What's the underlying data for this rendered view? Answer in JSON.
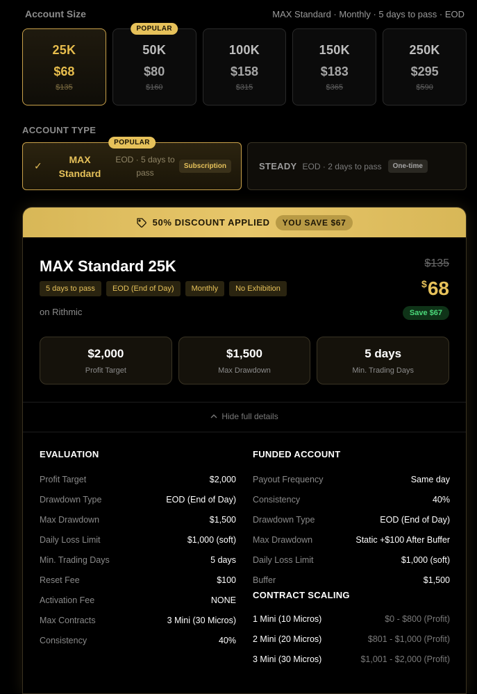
{
  "header": {
    "account_size_label": "Account Size",
    "summary": "MAX Standard · Monthly · 5 days to pass · EOD"
  },
  "account_sizes": [
    {
      "name": "25K",
      "price": "$68",
      "old_price": "$135",
      "selected": true,
      "badge": ""
    },
    {
      "name": "50K",
      "price": "$80",
      "old_price": "$160",
      "selected": false,
      "badge": "POPULAR"
    },
    {
      "name": "100K",
      "price": "$158",
      "old_price": "$315",
      "selected": false,
      "badge": ""
    },
    {
      "name": "150K",
      "price": "$183",
      "old_price": "$365",
      "selected": false,
      "badge": ""
    },
    {
      "name": "250K",
      "price": "$295",
      "old_price": "$590",
      "selected": false,
      "badge": ""
    }
  ],
  "account_type": {
    "label": "ACCOUNT TYPE",
    "max": {
      "check": "✓",
      "name_line1": "MAX",
      "name_line2": "Standard",
      "desc": "EOD · 5 days to pass",
      "tag": "Subscription",
      "badge": "POPULAR"
    },
    "steady": {
      "name": "STEADY",
      "desc": "EOD · 2 days to pass",
      "tag": "One-time"
    }
  },
  "banner": {
    "icon": "tag-icon",
    "text": "50% DISCOUNT APPLIED",
    "save": "YOU SAVE $67"
  },
  "plan": {
    "title": "MAX Standard 25K",
    "chips": [
      "5 days to pass",
      "EOD (End of Day)",
      "Monthly",
      "No Exhibition"
    ],
    "platform": "on Rithmic",
    "old_price": "$135",
    "currency": "$",
    "price": "68",
    "save": "Save $67"
  },
  "stats": [
    {
      "value": "$2,000",
      "label": "Profit Target"
    },
    {
      "value": "$1,500",
      "label": "Max Drawdown"
    },
    {
      "value": "5 days",
      "label": "Min. Trading Days"
    }
  ],
  "toggle": {
    "icon": "chevron-up-icon",
    "label": "Hide full details"
  },
  "evaluation": {
    "title": "EVALUATION",
    "rows": [
      {
        "k": "Profit Target",
        "v": "$2,000"
      },
      {
        "k": "Drawdown Type",
        "v": "EOD (End of Day)"
      },
      {
        "k": "Max Drawdown",
        "v": "$1,500"
      },
      {
        "k": "Daily Loss Limit",
        "v": "$1,000 (soft)"
      },
      {
        "k": "Min. Trading Days",
        "v": "5 days"
      },
      {
        "k": "Reset Fee",
        "v": "$100"
      },
      {
        "k": "Activation Fee",
        "v": "NONE"
      },
      {
        "k": "Max Contracts",
        "v": "3 Mini (30 Micros)"
      },
      {
        "k": "Consistency",
        "v": "40%"
      }
    ]
  },
  "funded": {
    "title": "FUNDED ACCOUNT",
    "rows": [
      {
        "k": "Payout Frequency",
        "v": "Same day"
      },
      {
        "k": "Consistency",
        "v": "40%"
      },
      {
        "k": "Drawdown Type",
        "v": "EOD (End of Day)"
      },
      {
        "k": "Max Drawdown",
        "v": "Static +$100 After Buffer"
      },
      {
        "k": "Daily Loss Limit",
        "v": "$1,000 (soft)"
      },
      {
        "k": "Buffer",
        "v": "$1,500"
      }
    ],
    "scaling_title": "CONTRACT SCALING",
    "scaling": [
      {
        "k": "1 Mini (10 Micros)",
        "v": "$0 - $800 (Profit)"
      },
      {
        "k": "2 Mini (20 Micros)",
        "v": "$801 - $1,000 (Profit)"
      },
      {
        "k": "3 Mini (30 Micros)",
        "v": "$1,001 - $2,000 (Profit)"
      }
    ]
  },
  "colors": {
    "accent": "#e6c15a",
    "green": "#4bd97a",
    "background": "#000000"
  }
}
